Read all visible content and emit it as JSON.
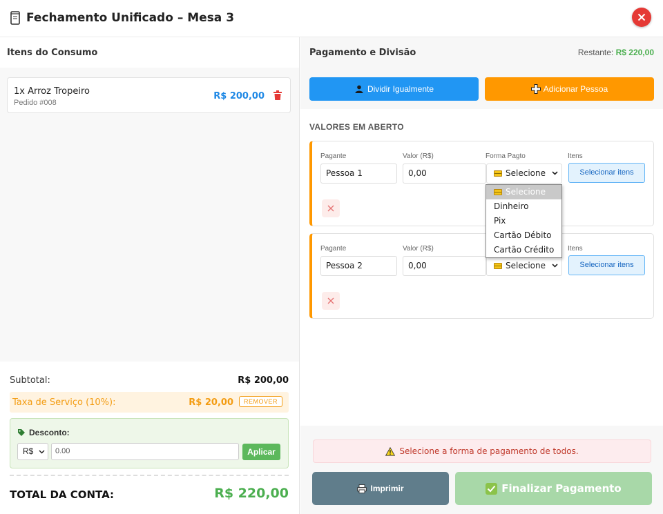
{
  "header": {
    "title": "Fechamento Unificado – Mesa 3",
    "title_icon": "document-icon",
    "close_icon": "close-icon"
  },
  "items_panel": {
    "title": "Itens do Consumo",
    "items": [
      {
        "name": "1x Arroz Tropeiro",
        "order": "Pedido #008",
        "price": "R$ 200,00"
      }
    ]
  },
  "summary": {
    "subtotal_label": "Subtotal:",
    "subtotal_value": "R$ 200,00",
    "service_label": "Taxa de Serviço (10%):",
    "service_value": "R$ 20,00",
    "service_remove": "REMOVER",
    "discount_title": "Desconto:",
    "discount_type": "R$",
    "discount_value": "0.00",
    "discount_apply": "Aplicar",
    "total_label": "TOTAL DA CONTA:",
    "total_value": "R$ 220,00"
  },
  "payment_panel": {
    "title": "Pagamento e Divisão",
    "remaining_label": "Restante:",
    "remaining_value": "R$ 220,00",
    "split_button": "Dividir Igualmente",
    "add_person_button": "Adicionar Pessoa",
    "open_values_title": "VALORES EM ABERTO",
    "col_payer": "Pagante",
    "col_value": "Valor (R$)",
    "col_method": "Forma Pagto",
    "col_items": "Itens",
    "payers": [
      {
        "name": "Pessoa 1",
        "value": "0,00",
        "method": "Selecione",
        "items_button": "Selecionar itens"
      },
      {
        "name": "Pessoa 2",
        "value": "0,00",
        "method": "Selecione",
        "items_button": "Selecionar itens"
      }
    ],
    "dropdown_options": [
      "Selecione",
      "Dinheiro",
      "Pix",
      "Cartão Débito",
      "Cartão Crédito"
    ],
    "warning": "Selecione a forma de pagamento de todos.",
    "print_button": "Imprimir",
    "finalize_button": "Finalizar Pagamento"
  },
  "colors": {
    "primary_blue": "#2196f3",
    "orange": "#ff9800",
    "green": "#4caf50",
    "danger": "#e53935"
  }
}
